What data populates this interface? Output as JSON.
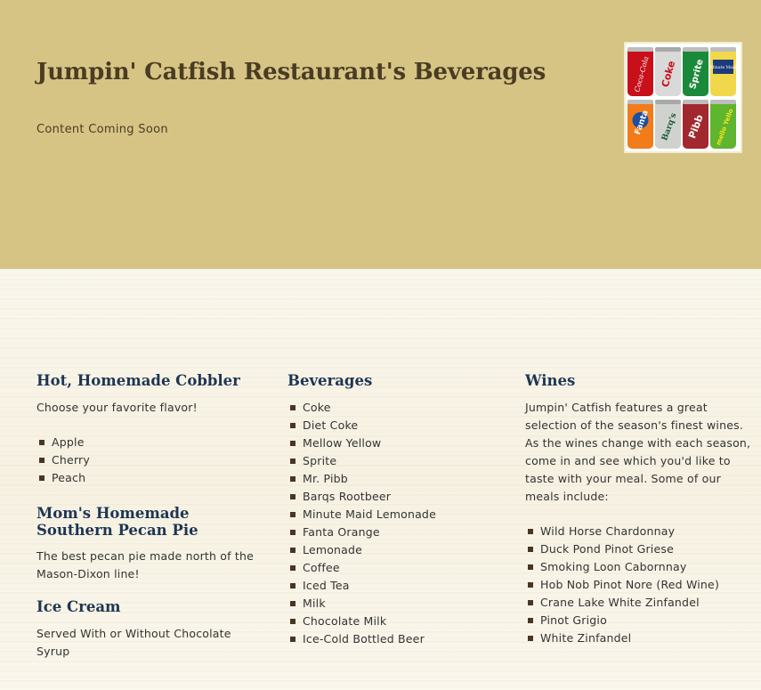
{
  "header": {
    "title": "Jumpin' Catfish Restaurant's Beverages",
    "subtitle": "Content Coming Soon",
    "background_color": "#d6c484"
  },
  "columns": {
    "cobbler": {
      "heading": "Hot, Homemade Cobbler",
      "intro": "Choose your favorite flavor!",
      "items": [
        "Apple",
        "Cherry",
        "Peach"
      ]
    },
    "pecan_pie": {
      "heading": "Mom's Homemade Southern Pecan Pie",
      "description": "The best pecan pie made north of the Mason-Dixon line!"
    },
    "ice_cream": {
      "heading": "Ice Cream",
      "description": "Served With or Without Chocolate Syrup"
    },
    "beverages": {
      "heading": "Beverages",
      "items": [
        "Coke",
        "Diet Coke",
        "Mellow Yellow",
        "Sprite",
        "Mr. Pibb",
        "Barqs Rootbeer",
        "Minute Maid Lemonade",
        "Fanta Orange",
        "Lemonade",
        "Coffee",
        "Iced Tea",
        "Milk",
        "Chocolate Milk",
        "Ice-Cold Bottled Beer"
      ]
    },
    "wines": {
      "heading": "Wines",
      "intro": "Jumpin' Catfish features a great selection of the season's finest wines. As the wines change with each season, come in and see which you'd like to taste with your meal. Some of our meals include:",
      "items": [
        "Wild Horse Chardonnay",
        "Duck Pond Pinot Griese",
        "Smoking Loon Cabornnay",
        "Hob Nob Pinot Nore (Red Wine)",
        "Crane Lake White Zinfandel",
        "Pinot Grigio",
        "White Zinfandel"
      ]
    }
  },
  "colors": {
    "heading": "#1e3653",
    "header_text": "#4a3c24",
    "bullet": "#4a3524"
  },
  "can_photo": {
    "top_row": [
      "Coca-Cola",
      "Coke",
      "Sprite",
      "Minute Maid"
    ],
    "bottom_row": [
      "Fanta",
      "Barq's",
      "Pibb",
      "mello Yello"
    ]
  }
}
